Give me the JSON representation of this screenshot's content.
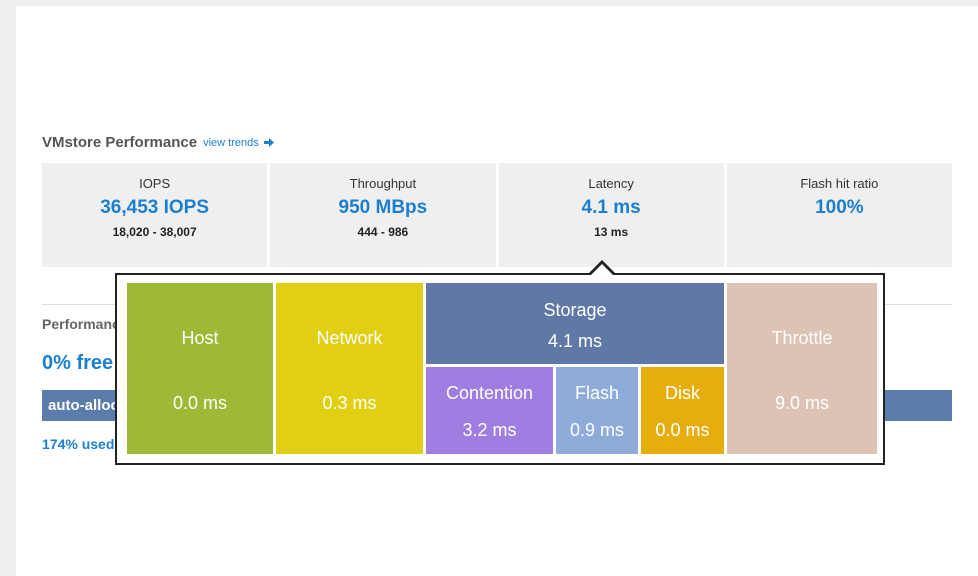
{
  "header": {
    "title": "VMstore Performance",
    "view_trends_label": "view trends"
  },
  "metrics": [
    {
      "label": "IOPS",
      "value": "36,453 IOPS",
      "range": "18,020 - 38,007"
    },
    {
      "label": "Throughput",
      "value": "950 MBps",
      "range": "444 - 986"
    },
    {
      "label": "Latency",
      "value": "4.1 ms",
      "range": "13 ms"
    },
    {
      "label": "Flash hit ratio",
      "value": "100%",
      "range": ""
    }
  ],
  "background": {
    "perf_label": "Performance",
    "free_text": "0% free",
    "bar_label": "auto-allocated",
    "used_text": "174% used"
  },
  "latency_breakdown": {
    "host": {
      "label": "Host",
      "value": "0.0 ms",
      "color": "#9eb935"
    },
    "network": {
      "label": "Network",
      "value": "0.3 ms",
      "color": "#e0cf12"
    },
    "storage": {
      "label": "Storage",
      "value": "4.1 ms",
      "color": "#5f78a6"
    },
    "contention": {
      "label": "Contention",
      "value": "3.2 ms",
      "color": "#a07de0"
    },
    "flash": {
      "label": "Flash",
      "value": "0.9 ms",
      "color": "#8eabd9"
    },
    "disk": {
      "label": "Disk",
      "value": "0.0 ms",
      "color": "#e6ad0e"
    },
    "throttle": {
      "label": "Throttle",
      "value": "9.0 ms",
      "color": "#dcc3b4"
    }
  },
  "colors": {
    "accent_blue": "#1b7fcf",
    "panel_gray": "#efefef"
  }
}
